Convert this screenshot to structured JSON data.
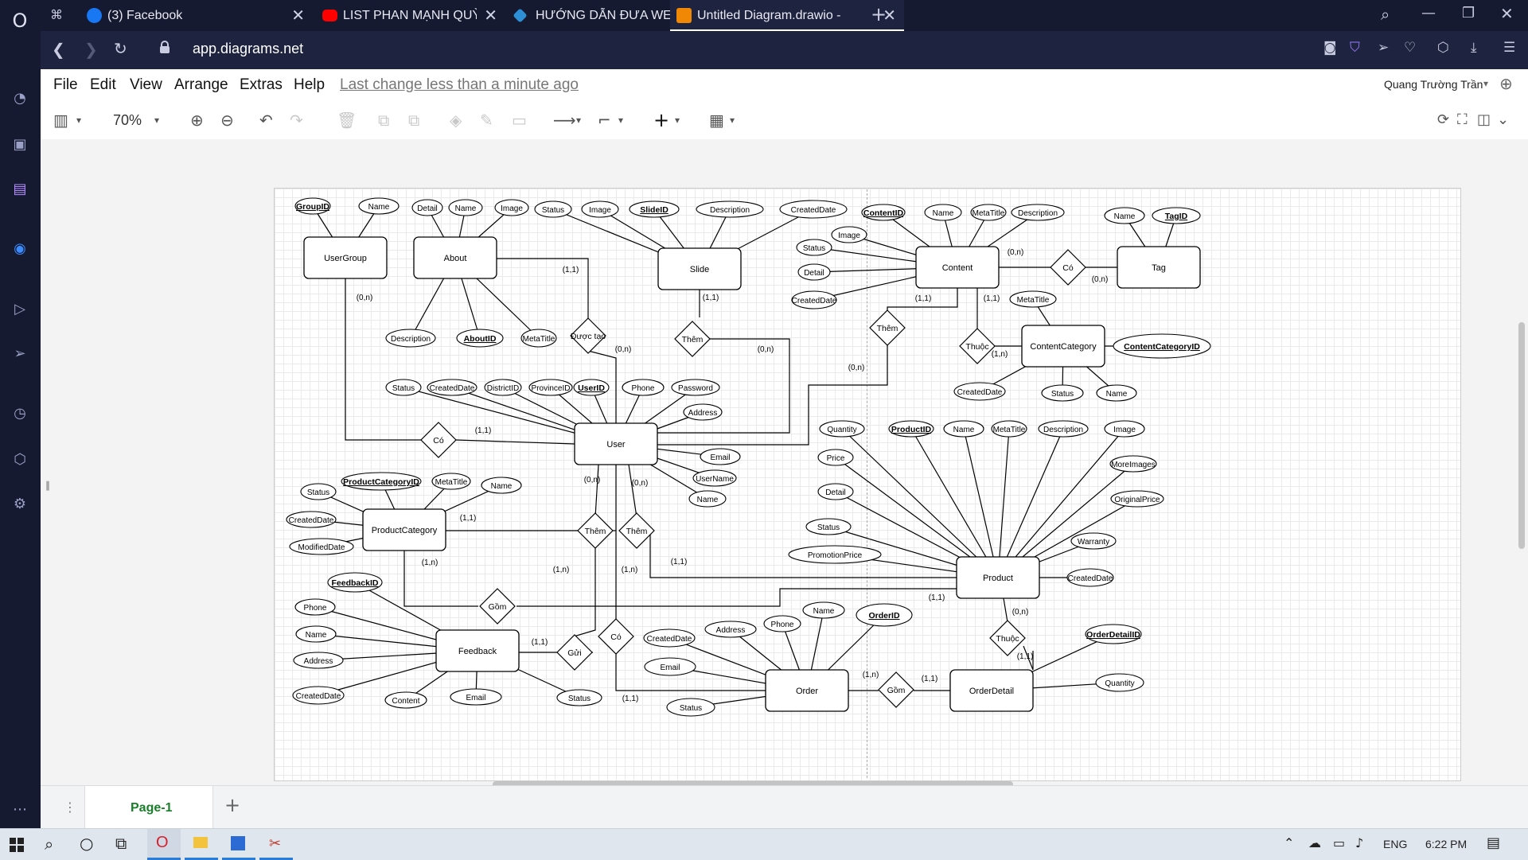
{
  "browser": {
    "tabs": [
      {
        "label": "(3) Facebook"
      },
      {
        "label": "LIST PHAN MẠNH QUỲNH"
      },
      {
        "label": "HƯỚNG DẪN ĐƯA WEBSIT"
      },
      {
        "label": "Untitled Diagram.drawio - "
      }
    ],
    "url": "app.diagrams.net"
  },
  "app": {
    "menus": [
      "File",
      "Edit",
      "View",
      "Arrange",
      "Extras",
      "Help"
    ],
    "last_change": "Last change less than a minute ago",
    "user": "Quang Trường Trần",
    "zoom": "70%",
    "page_tab": "Page-1"
  },
  "taskbar": {
    "lang": "ENG",
    "time": "6:22 PM"
  },
  "diagram": {
    "entities": [
      {
        "id": "usergroup",
        "label": "UserGroup"
      },
      {
        "id": "about",
        "label": "About"
      },
      {
        "id": "slide",
        "label": "Slide"
      },
      {
        "id": "content",
        "label": "Content"
      },
      {
        "id": "tag",
        "label": "Tag"
      },
      {
        "id": "contentcategory",
        "label": "ContentCategory"
      },
      {
        "id": "user",
        "label": "User"
      },
      {
        "id": "productcategory",
        "label": "ProductCategory"
      },
      {
        "id": "product",
        "label": "Product"
      },
      {
        "id": "feedback",
        "label": "Feedback"
      },
      {
        "id": "order",
        "label": "Order"
      },
      {
        "id": "orderdetail",
        "label": "OrderDetail"
      }
    ],
    "relationships": [
      {
        "id": "r_duoctao",
        "label": "Được tạo"
      },
      {
        "id": "r_them_slide",
        "label": "Thêm"
      },
      {
        "id": "r_them_content",
        "label": "Thêm"
      },
      {
        "id": "r_co_tag",
        "label": "Có"
      },
      {
        "id": "r_thuoc_cc",
        "label": "Thuộc"
      },
      {
        "id": "r_co_group",
        "label": "Có"
      },
      {
        "id": "r_them_pc",
        "label": "Thêm"
      },
      {
        "id": "r_them_prod",
        "label": "Thêm"
      },
      {
        "id": "r_gom_pc",
        "label": "Gồm"
      },
      {
        "id": "r_gui",
        "label": "Gửi"
      },
      {
        "id": "r_co_order",
        "label": "Có"
      },
      {
        "id": "r_gom_od",
        "label": "Gồm"
      },
      {
        "id": "r_thuoc_od",
        "label": "Thuộc"
      }
    ],
    "attributes": [
      {
        "id": "a1",
        "label": "GroupID",
        "key": true
      },
      {
        "id": "a2",
        "label": "Name"
      },
      {
        "id": "a3",
        "label": "Detail"
      },
      {
        "id": "a4",
        "label": "Name"
      },
      {
        "id": "a5",
        "label": "Image"
      },
      {
        "id": "a6",
        "label": "Description"
      },
      {
        "id": "a7",
        "label": "AboutID",
        "key": true
      },
      {
        "id": "a8",
        "label": "MetaTitle"
      },
      {
        "id": "a9",
        "label": "Status"
      },
      {
        "id": "a10",
        "label": "Image"
      },
      {
        "id": "a11",
        "label": "SlideID",
        "key": true
      },
      {
        "id": "a12",
        "label": "Description"
      },
      {
        "id": "a13",
        "label": "CreatedDate"
      },
      {
        "id": "a14",
        "label": "ContentID",
        "key": true
      },
      {
        "id": "a15",
        "label": "Name"
      },
      {
        "id": "a16",
        "label": "MetaTitle"
      },
      {
        "id": "a17",
        "label": "Description"
      },
      {
        "id": "a18",
        "label": "Image"
      },
      {
        "id": "a19",
        "label": "Status"
      },
      {
        "id": "a20",
        "label": "Detail"
      },
      {
        "id": "a21",
        "label": "CreatedDate"
      },
      {
        "id": "a22",
        "label": "Name"
      },
      {
        "id": "a23",
        "label": "TagID",
        "key": true
      },
      {
        "id": "a24",
        "label": "MetaTitle"
      },
      {
        "id": "a25",
        "label": "ContentCategoryID",
        "key": true
      },
      {
        "id": "a26",
        "label": "CreatedDate"
      },
      {
        "id": "a27",
        "label": "Status"
      },
      {
        "id": "a28",
        "label": "Name"
      },
      {
        "id": "a29",
        "label": "Status"
      },
      {
        "id": "a30",
        "label": "CreatedDate"
      },
      {
        "id": "a31",
        "label": "DistrictID"
      },
      {
        "id": "a32",
        "label": "ProvinceID"
      },
      {
        "id": "a33",
        "label": "UserID",
        "key": true
      },
      {
        "id": "a34",
        "label": "Phone"
      },
      {
        "id": "a35",
        "label": "Password"
      },
      {
        "id": "a36",
        "label": "Address"
      },
      {
        "id": "a37",
        "label": "Email"
      },
      {
        "id": "a38",
        "label": "UserName"
      },
      {
        "id": "a39",
        "label": "Name"
      },
      {
        "id": "a40",
        "label": "Status"
      },
      {
        "id": "a41",
        "label": "ProductCategoryID",
        "key": true
      },
      {
        "id": "a42",
        "label": "MetaTitle"
      },
      {
        "id": "a43",
        "label": "Name"
      },
      {
        "id": "a44",
        "label": "CreatedDate"
      },
      {
        "id": "a45",
        "label": "ModifiedDate"
      },
      {
        "id": "a46",
        "label": "Quantity"
      },
      {
        "id": "a47",
        "label": "ProductID",
        "key": true
      },
      {
        "id": "a48",
        "label": "Name"
      },
      {
        "id": "a49",
        "label": "MetaTitle"
      },
      {
        "id": "a50",
        "label": "Description"
      },
      {
        "id": "a51",
        "label": "Image"
      },
      {
        "id": "a52",
        "label": "Price"
      },
      {
        "id": "a53",
        "label": "MoreImages"
      },
      {
        "id": "a54",
        "label": "Detail"
      },
      {
        "id": "a55",
        "label": "OriginalPrice"
      },
      {
        "id": "a56",
        "label": "Status"
      },
      {
        "id": "a57",
        "label": "Warranty"
      },
      {
        "id": "a58",
        "label": "PromotionPrice"
      },
      {
        "id": "a59",
        "label": "CreatedDate"
      },
      {
        "id": "a60",
        "label": "FeedbackID",
        "key": true
      },
      {
        "id": "a61",
        "label": "Phone"
      },
      {
        "id": "a62",
        "label": "Name"
      },
      {
        "id": "a63",
        "label": "Address"
      },
      {
        "id": "a64",
        "label": "CreatedDate"
      },
      {
        "id": "a65",
        "label": "Content"
      },
      {
        "id": "a66",
        "label": "Email"
      },
      {
        "id": "a67",
        "label": "Status"
      },
      {
        "id": "a68",
        "label": "CreatedDate"
      },
      {
        "id": "a69",
        "label": "Address"
      },
      {
        "id": "a70",
        "label": "Phone"
      },
      {
        "id": "a71",
        "label": "Name"
      },
      {
        "id": "a72",
        "label": "OrderID",
        "key": true
      },
      {
        "id": "a73",
        "label": "Email"
      },
      {
        "id": "a74",
        "label": "Status"
      },
      {
        "id": "a75",
        "label": "OrderDetailID",
        "key": true
      },
      {
        "id": "a76",
        "label": "Quantity"
      }
    ],
    "cardinalities": [
      {
        "id": "c1",
        "label": "(0,n)"
      },
      {
        "id": "c2",
        "label": "(1,1)"
      },
      {
        "id": "c3",
        "label": "(0,n)"
      },
      {
        "id": "c4",
        "label": "(1,1)"
      },
      {
        "id": "c5",
        "label": "(0,n)"
      },
      {
        "id": "c6",
        "label": "(0,n)"
      },
      {
        "id": "c7",
        "label": "(0,n)"
      },
      {
        "id": "c8",
        "label": "(1,1)"
      },
      {
        "id": "c9",
        "label": "(1,1)"
      },
      {
        "id": "c10",
        "label": "(1,n)"
      },
      {
        "id": "c11",
        "label": "(0,n)"
      },
      {
        "id": "c12",
        "label": "(1,1)"
      },
      {
        "id": "c13",
        "label": "(0,n)"
      },
      {
        "id": "c14",
        "label": "(0,n)"
      },
      {
        "id": "c15",
        "label": "(1,1)"
      },
      {
        "id": "c16",
        "label": "(1,n)"
      },
      {
        "id": "c17",
        "label": "(1,n)"
      },
      {
        "id": "c18",
        "label": "(1,n)"
      },
      {
        "id": "c19",
        "label": "(1,1)"
      },
      {
        "id": "c20",
        "label": "(1,1)"
      },
      {
        "id": "c21",
        "label": "(1,1)"
      },
      {
        "id": "c22",
        "label": "(1,n)"
      },
      {
        "id": "c23",
        "label": "(1,1)"
      },
      {
        "id": "c24",
        "label": "(0,n)"
      },
      {
        "id": "c25",
        "label": "(1,1)"
      },
      {
        "id": "c26",
        "label": "(1,1)"
      }
    ]
  }
}
